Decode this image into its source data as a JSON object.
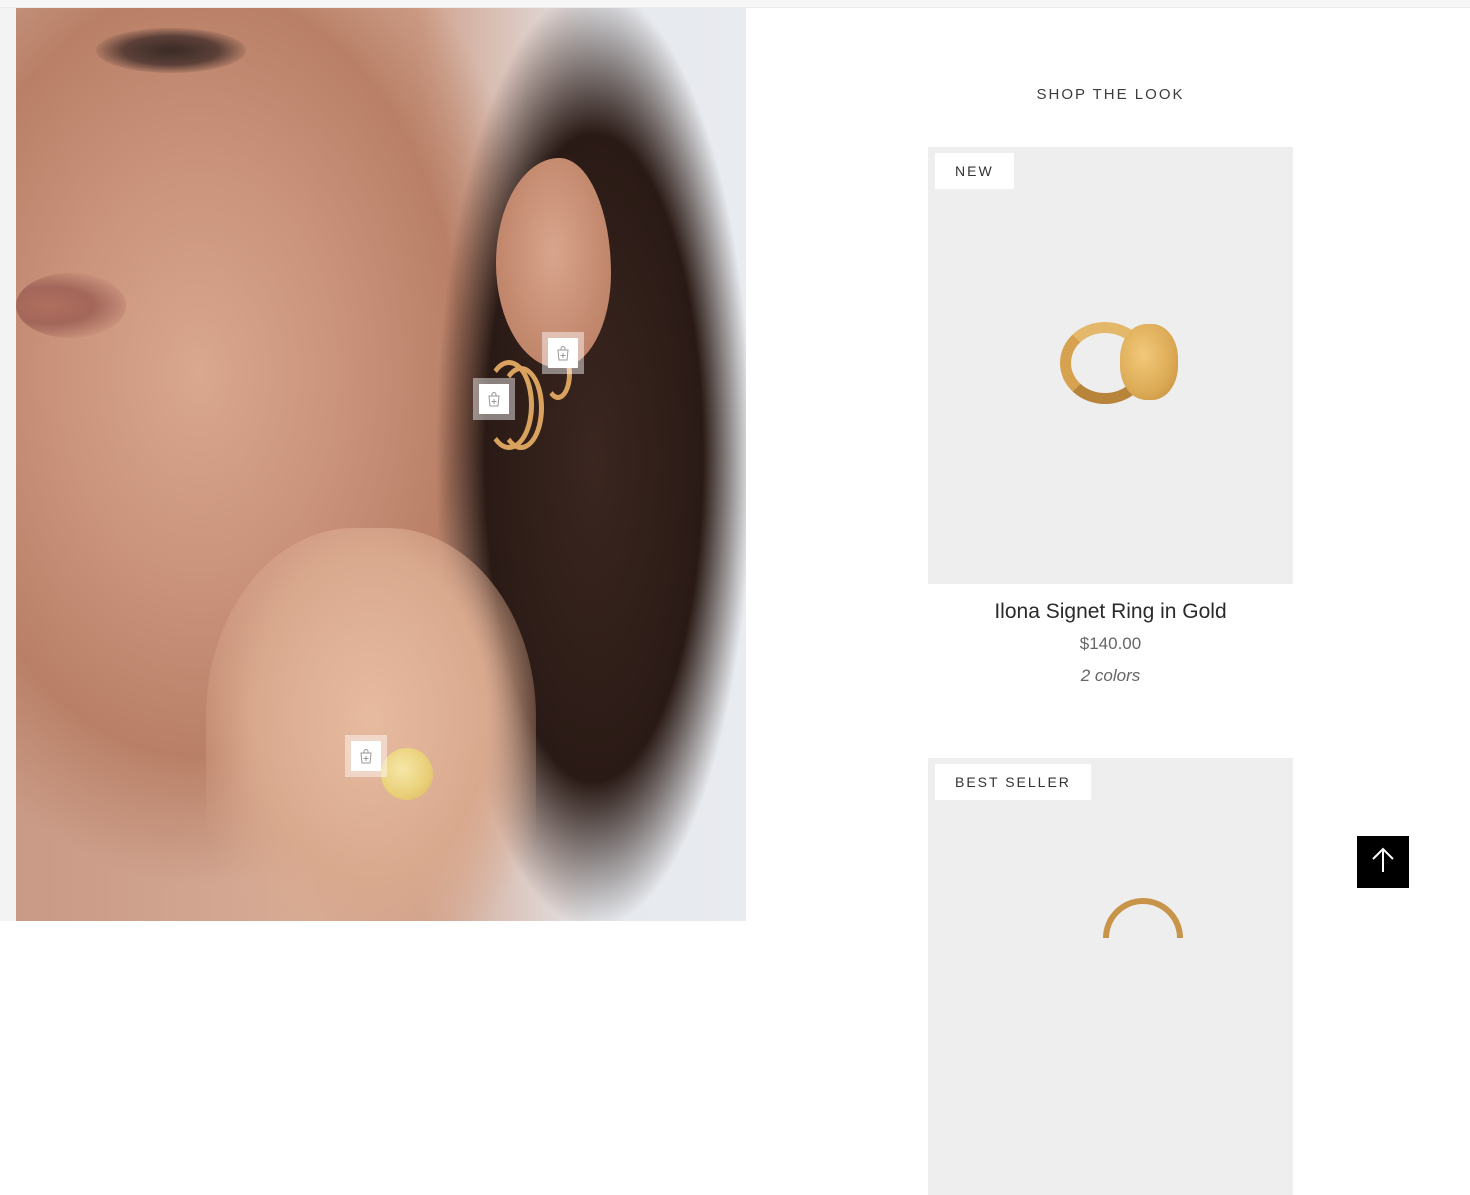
{
  "section": {
    "title": "SHOP THE LOOK"
  },
  "hotspots": [
    {
      "icon": "shopping-bag-plus-icon"
    },
    {
      "icon": "shopping-bag-plus-icon"
    },
    {
      "icon": "shopping-bag-plus-icon"
    }
  ],
  "products": [
    {
      "badge": "NEW",
      "name": "Ilona Signet Ring in Gold",
      "price": "$140.00",
      "colors": "2 colors"
    },
    {
      "badge": "BEST SELLER"
    }
  ],
  "back_to_top": {
    "icon": "arrow-up-icon"
  },
  "colors": {
    "accent_black": "#000000",
    "card_bg": "#eeeeee",
    "gold": "#d6a24f"
  }
}
